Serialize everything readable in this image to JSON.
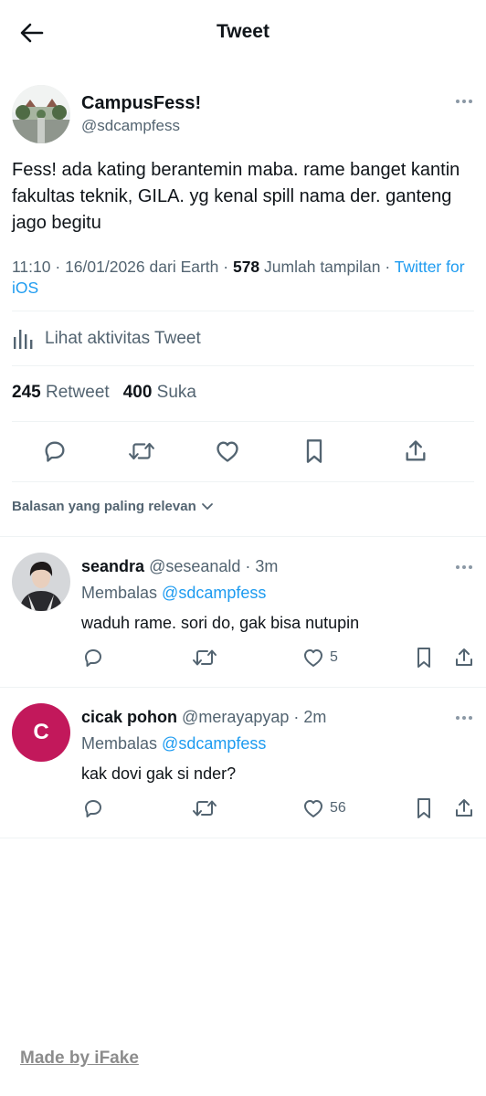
{
  "header": {
    "title": "Tweet"
  },
  "tweet": {
    "author_name": "CampusFess!",
    "author_handle": "@sdcampfess",
    "text": "Fess! ada kating berantemin maba. rame banget kantin fakultas teknik, GILA. yg kenal spill nama der. ganteng jago begitu",
    "time": "11:10",
    "date": "16/01/2026",
    "location": "dari Earth",
    "views_count": "578",
    "views_label": "Jumlah tampilan",
    "source": "Twitter for iOS",
    "activity_label": "Lihat aktivitas Tweet",
    "retweet_count": "245",
    "retweet_label": "Retweet",
    "like_count": "400",
    "like_label": "Suka"
  },
  "sort_label": "Balasan yang paling relevan",
  "replies": [
    {
      "name": "seandra",
      "handle": "@seseanald",
      "time": "3m",
      "replying_to_label": "Membalas",
      "replying_to": "@sdcampfess",
      "text": "waduh rame. sori do, gak bisa nutupin",
      "like_count": "5",
      "avatar": "photo"
    },
    {
      "name": "cicak pohon",
      "handle": "@merayapyap",
      "time": "2m",
      "replying_to_label": "Membalas",
      "replying_to": "@sdcampfess",
      "text": "kak dovi gak si nder?",
      "like_count": "56",
      "avatar_letter": "C"
    }
  ],
  "watermark": "Made by iFake",
  "colors": {
    "link": "#1d9bf0",
    "secondary": "#536471",
    "text": "#0f1419",
    "divider": "#eff3f4",
    "letter_avatar": "#c2185b"
  }
}
